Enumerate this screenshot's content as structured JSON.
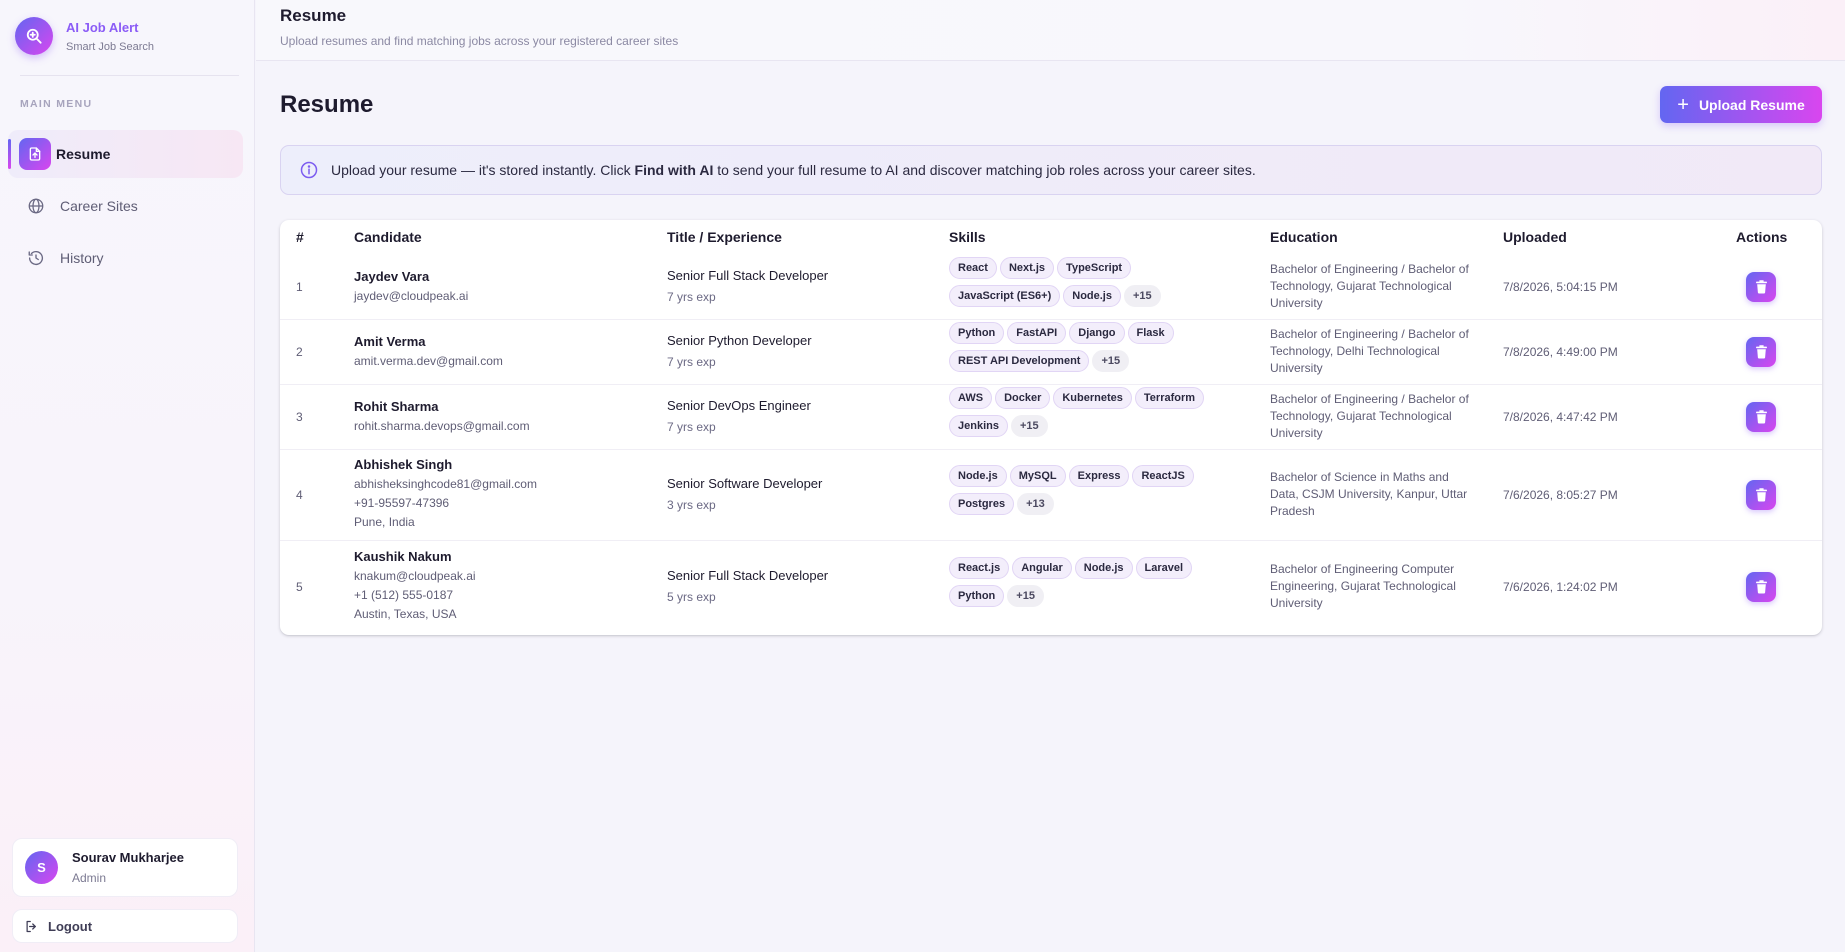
{
  "brand": {
    "title": "AI Job Alert",
    "subtitle": "Smart Job Search"
  },
  "sidebar": {
    "menu_label": "MAIN MENU",
    "items": [
      {
        "label": "Resume",
        "icon": "file-upload-icon",
        "active": true
      },
      {
        "label": "Career Sites",
        "icon": "globe-icon",
        "active": false
      },
      {
        "label": "History",
        "icon": "history-icon",
        "active": false
      }
    ]
  },
  "user": {
    "initial": "S",
    "name": "Sourav Mukharjee",
    "role": "Admin"
  },
  "logout_label": "Logout",
  "topbar": {
    "title": "Resume",
    "subtitle": "Upload resumes and find matching jobs across your registered career sites"
  },
  "page": {
    "title": "Resume",
    "upload_label": "Upload Resume",
    "info_prefix": "Upload your resume — it's stored instantly. Click ",
    "info_bold": "Find with AI",
    "info_suffix": " to send your full resume to AI and discover matching job roles across your career sites."
  },
  "table": {
    "headers": {
      "num": "#",
      "candidate": "Candidate",
      "title": "Title / Experience",
      "skills": "Skills",
      "education": "Education",
      "uploaded": "Uploaded",
      "actions": "Actions"
    },
    "rows": [
      {
        "num": "1",
        "name": "Jaydev Vara",
        "lines": [
          "jaydev@cloudpeak.ai"
        ],
        "title": "Senior Full Stack Developer",
        "exp": "7 yrs exp",
        "skills": [
          "React",
          "Next.js",
          "TypeScript",
          "JavaScript (ES6+)",
          "Node.js"
        ],
        "more": "+15",
        "education": "Bachelor of Engineering / Bachelor of Technology, Gujarat Technological University",
        "uploaded": "7/8/2026, 5:04:15 PM"
      },
      {
        "num": "2",
        "name": "Amit Verma",
        "lines": [
          "amit.verma.dev@gmail.com"
        ],
        "title": "Senior Python Developer",
        "exp": "7 yrs exp",
        "skills": [
          "Python",
          "FastAPI",
          "Django",
          "Flask",
          "REST API Development"
        ],
        "more": "+15",
        "education": "Bachelor of Engineering / Bachelor of Technology, Delhi Technological University",
        "uploaded": "7/8/2026, 4:49:00 PM"
      },
      {
        "num": "3",
        "name": "Rohit Sharma",
        "lines": [
          "rohit.sharma.devops@gmail.com"
        ],
        "title": "Senior DevOps Engineer",
        "exp": "7 yrs exp",
        "skills": [
          "AWS",
          "Docker",
          "Kubernetes",
          "Terraform",
          "Jenkins"
        ],
        "more": "+15",
        "education": "Bachelor of Engineering / Bachelor of Technology, Gujarat Technological University",
        "uploaded": "7/8/2026, 4:47:42 PM"
      },
      {
        "num": "4",
        "name": "Abhishek Singh",
        "lines": [
          "abhisheksinghcode81@gmail.com",
          "+91-95597-47396",
          "Pune, India"
        ],
        "title": "Senior Software Developer",
        "exp": "3 yrs exp",
        "skills": [
          "Node.js",
          "MySQL",
          "Express",
          "ReactJS",
          "Postgres"
        ],
        "more": "+13",
        "education": "Bachelor of Science in Maths and Data, CSJM University, Kanpur, Uttar Pradesh",
        "uploaded": "7/6/2026, 8:05:27 PM"
      },
      {
        "num": "5",
        "name": "Kaushik Nakum",
        "lines": [
          "knakum@cloudpeak.ai",
          "+1 (512) 555-0187",
          "Austin, Texas, USA"
        ],
        "title": "Senior Full Stack Developer",
        "exp": "5 yrs exp",
        "skills": [
          "React.js",
          "Angular",
          "Node.js",
          "Laravel",
          "Python"
        ],
        "more": "+15",
        "education": "Bachelor of Engineering Computer Engineering, Gujarat Technological University",
        "uploaded": "7/6/2026, 1:24:02 PM"
      }
    ]
  },
  "colors": {
    "accent_start": "#6366f1",
    "accent_end": "#d946ef",
    "brand_text": "#8b5cf6"
  }
}
